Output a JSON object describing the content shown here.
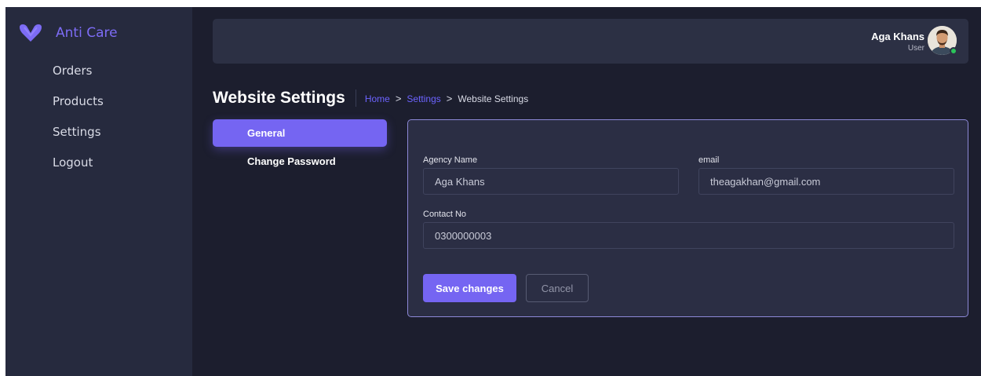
{
  "sidebar": {
    "brand": "Anti Care",
    "brand_color": "#7d6cf5",
    "logo_icon": "v-heart-logo-icon",
    "items": [
      {
        "label": "Orders"
      },
      {
        "label": "Products"
      },
      {
        "label": "Settings"
      },
      {
        "label": "Logout"
      }
    ]
  },
  "topbar": {
    "user_name": "Aga Khans",
    "user_role": "User",
    "status_color": "#2bc35a"
  },
  "page": {
    "title": "Website Settings",
    "breadcrumb": {
      "home": "Home",
      "separator": ">",
      "settings": "Settings",
      "current": "Website Settings"
    }
  },
  "tabs": [
    {
      "label": "General",
      "active": true
    },
    {
      "label": "Change Password",
      "active": false
    }
  ],
  "form": {
    "agency_name_label": "Agency Name",
    "agency_name_value": "Aga Khans",
    "email_label": "email",
    "email_value": "theagakhan@gmail.com",
    "contact_label": "Contact No",
    "contact_value": "0300000003",
    "save_label": "Save changes",
    "cancel_label": "Cancel"
  },
  "colors": {
    "accent": "#7565f2",
    "background": "#1c1e2e",
    "sidebar": "#262a3e",
    "card": "#2b2e44"
  }
}
